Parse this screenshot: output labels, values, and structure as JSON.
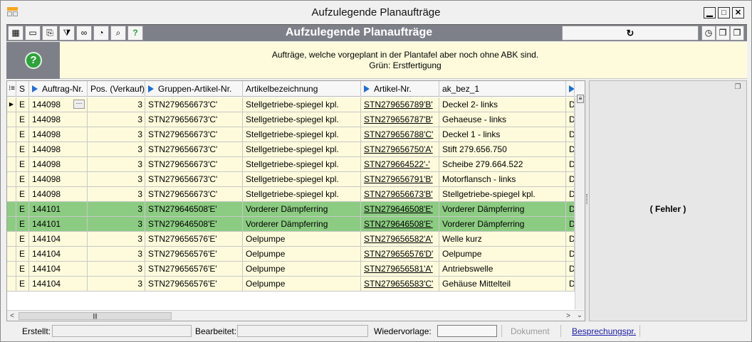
{
  "window": {
    "title": "Aufzulegende Planaufträge",
    "controls": {
      "minimize": "▁",
      "maximize": "□",
      "close": "✕"
    }
  },
  "toolbar": {
    "title": "Aufzulegende Planaufträge",
    "refresh_symbol": "↻",
    "left_buttons": [
      {
        "name": "grid-layout-icon",
        "glyph": "▦"
      },
      {
        "name": "window-icon",
        "glyph": "▭"
      },
      {
        "name": "copy-document-icon",
        "glyph": "⎘"
      },
      {
        "name": "filter-icon",
        "glyph": "⧩"
      },
      {
        "name": "view-glasses-icon",
        "glyph": "∞"
      },
      {
        "name": "clock-document-icon",
        "glyph": "◔"
      },
      {
        "name": "search-magnifier-icon",
        "glyph": "⌕"
      },
      {
        "name": "help-icon",
        "glyph": "?"
      }
    ],
    "right_buttons": [
      {
        "name": "clock-icon",
        "glyph": "◷"
      },
      {
        "name": "cube-icon",
        "glyph": "❒"
      },
      {
        "name": "cube-green-icon",
        "glyph": "❒"
      }
    ]
  },
  "banner": {
    "help_glyph": "?",
    "line1": "Aufträge, welche vorgeplant in der Plantafel aber noch ohne ABK sind.",
    "line2": "Grün: Erstfertigung"
  },
  "grid": {
    "columns": [
      {
        "label": "S",
        "arrow": false
      },
      {
        "label": "Auftrag-Nr.",
        "arrow": true
      },
      {
        "label": "Pos. (Verkauf)",
        "arrow": false
      },
      {
        "label": "Gruppen-Artikel-Nr.",
        "arrow": true
      },
      {
        "label": "Artikelbezeichnung",
        "arrow": false
      },
      {
        "label": "Artikel-Nr.",
        "arrow": true
      },
      {
        "label": "ak_bez_1",
        "arrow": false
      },
      {
        "label": "",
        "arrow": true
      }
    ],
    "rows": [
      {
        "s": "E",
        "auftrag": "144098",
        "pos": "3",
        "gruppe": "STN279656673'C'",
        "bez": "Stellgetriebe-spiegel kpl.",
        "artikel": "STN279656789'B'",
        "ak": "Deckel 2- links",
        "last": "D",
        "color": "yellow"
      },
      {
        "s": "E",
        "auftrag": "144098",
        "pos": "3",
        "gruppe": "STN279656673'C'",
        "bez": "Stellgetriebe-spiegel kpl.",
        "artikel": "STN279656787'B'",
        "ak": "Gehaeuse - links",
        "last": "D",
        "color": "yellow"
      },
      {
        "s": "E",
        "auftrag": "144098",
        "pos": "3",
        "gruppe": "STN279656673'C'",
        "bez": "Stellgetriebe-spiegel kpl.",
        "artikel": "STN279656788'C'",
        "ak": "Deckel 1 - links",
        "last": "D",
        "color": "yellow"
      },
      {
        "s": "E",
        "auftrag": "144098",
        "pos": "3",
        "gruppe": "STN279656673'C'",
        "bez": "Stellgetriebe-spiegel kpl.",
        "artikel": "STN279656750'A'",
        "ak": "Stift 279.656.750",
        "last": "D",
        "color": "yellow"
      },
      {
        "s": "E",
        "auftrag": "144098",
        "pos": "3",
        "gruppe": "STN279656673'C'",
        "bez": "Stellgetriebe-spiegel kpl.",
        "artikel": "STN279664522'-'",
        "ak": "Scheibe 279.664.522",
        "last": "D",
        "color": "yellow"
      },
      {
        "s": "E",
        "auftrag": "144098",
        "pos": "3",
        "gruppe": "STN279656673'C'",
        "bez": "Stellgetriebe-spiegel kpl.",
        "artikel": "STN279656791'B'",
        "ak": "Motorflansch - links",
        "last": "D",
        "color": "yellow"
      },
      {
        "s": "E",
        "auftrag": "144098",
        "pos": "3",
        "gruppe": "STN279656673'C'",
        "bez": "Stellgetriebe-spiegel kpl.",
        "artikel": "STN279656673'B'",
        "ak": "Stellgetriebe-spiegel kpl.",
        "last": "D",
        "color": "yellow"
      },
      {
        "s": "E",
        "auftrag": "144101",
        "pos": "3",
        "gruppe": "STN279646508'E'",
        "bez": "Vorderer Dämpferring",
        "artikel": "STN279646508'E'",
        "ak": "Vorderer Dämpferring",
        "last": "D",
        "color": "green"
      },
      {
        "s": "E",
        "auftrag": "144101",
        "pos": "3",
        "gruppe": "STN279646508'E'",
        "bez": "Vorderer Dämpferring",
        "artikel": "STN279646508'E'",
        "ak": "Vorderer Dämpferring",
        "last": "D",
        "color": "green"
      },
      {
        "s": "E",
        "auftrag": "144104",
        "pos": "3",
        "gruppe": "STN279656576'E'",
        "bez": "Oelpumpe",
        "artikel": "STN279656582'A'",
        "ak": "Welle kurz",
        "last": "D",
        "color": "yellow"
      },
      {
        "s": "E",
        "auftrag": "144104",
        "pos": "3",
        "gruppe": "STN279656576'E'",
        "bez": "Oelpumpe",
        "artikel": "STN279656576'D'",
        "ak": "Oelpumpe",
        "last": "D",
        "color": "yellow"
      },
      {
        "s": "E",
        "auftrag": "144104",
        "pos": "3",
        "gruppe": "STN279656576'E'",
        "bez": "Oelpumpe",
        "artikel": "STN279656581'A'",
        "ak": "Antriebswelle",
        "last": "D",
        "color": "yellow"
      },
      {
        "s": "E",
        "auftrag": "144104",
        "pos": "3",
        "gruppe": "STN279656576'E'",
        "bez": "Oelpumpe",
        "artikel": "STN279656583'C'",
        "ak": "Gehäuse Mittelteil",
        "last": "D",
        "color": "yellow"
      }
    ],
    "colors": {
      "yellow": "#fdfbdc",
      "green": "#8ccc82",
      "header_arrow": "#1e6fd9"
    }
  },
  "side_panel": {
    "text": "( Fehler )"
  },
  "statusbar": {
    "erstellt_label": "Erstellt:",
    "bearbeitet_label": "Bearbeitet:",
    "wiedervorlage_label": "Wiedervorlage:",
    "dokument_label": "Dokument",
    "besprechung_label": "Besprechungspr."
  }
}
